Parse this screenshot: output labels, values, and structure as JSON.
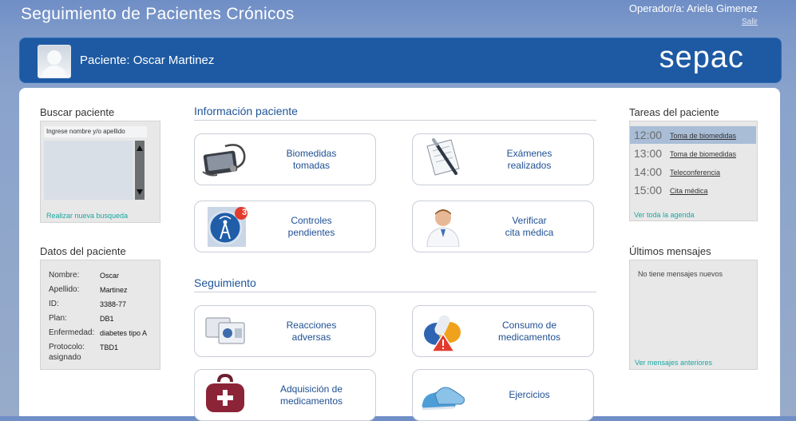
{
  "app": {
    "title": "Seguimiento de Pacientes Crónicos",
    "operator": "Operador/a: Ariela Gimenez",
    "logout": "Salir"
  },
  "header": {
    "patient": "Paciente: Oscar Martinez",
    "logo": "sepac"
  },
  "search": {
    "title": "Buscar paciente",
    "placeholder": "Ingrese nombre y/o apellido",
    "new_search": "Realizar nueva busqueda"
  },
  "patient_data": {
    "title": "Datos del paciente",
    "fields": [
      {
        "label": "Nombre:",
        "value": "Oscar"
      },
      {
        "label": "Apellido:",
        "value": "Martinez"
      },
      {
        "label": "ID:",
        "value": "3388-77"
      },
      {
        "label": "Plan:",
        "value": "DB1"
      },
      {
        "label": "Enfermedad:",
        "value": "diabetes tipo A"
      },
      {
        "label": "Protocolo:",
        "value": "TBD1"
      },
      {
        "label": "asignado",
        "value": ""
      }
    ]
  },
  "info": {
    "title": "Información paciente",
    "tiles": [
      {
        "label": "Biomedidas\ntomadas",
        "icon": "biomedical-device-icon"
      },
      {
        "label": "Exámenes\nrealizados",
        "icon": "exam-document-pen-icon"
      },
      {
        "label": "Controles\npendientes",
        "icon": "signal-tower-icon",
        "badge": "3"
      },
      {
        "label": "Verificar\ncita médica",
        "icon": "doctor-icon"
      }
    ]
  },
  "followup": {
    "title": "Seguimiento",
    "tiles": [
      {
        "label": "Reacciones\nadversas",
        "icon": "screens-icon"
      },
      {
        "label": "Consumo de\nmedicamentos",
        "icon": "pills-warning-icon"
      },
      {
        "label": "Adquisición de\nmedicamentos",
        "icon": "medical-bag-icon"
      },
      {
        "label": "Ejercicios",
        "icon": "sneakers-icon"
      }
    ]
  },
  "tasks": {
    "title": "Tareas del paciente",
    "items": [
      {
        "time": "12:00",
        "name": "Toma de biomedidas"
      },
      {
        "time": "13:00",
        "name": "Toma de biomedidas"
      },
      {
        "time": "14:00",
        "name": "Teleconferencia"
      },
      {
        "time": "15:00",
        "name": "Cita médica"
      }
    ],
    "view_all": "Ver toda la agenda"
  },
  "messages": {
    "title": "Últimos mensajes",
    "empty": "No tiene mensajes nuevos",
    "previous": "Ver mensajes anteriores"
  }
}
